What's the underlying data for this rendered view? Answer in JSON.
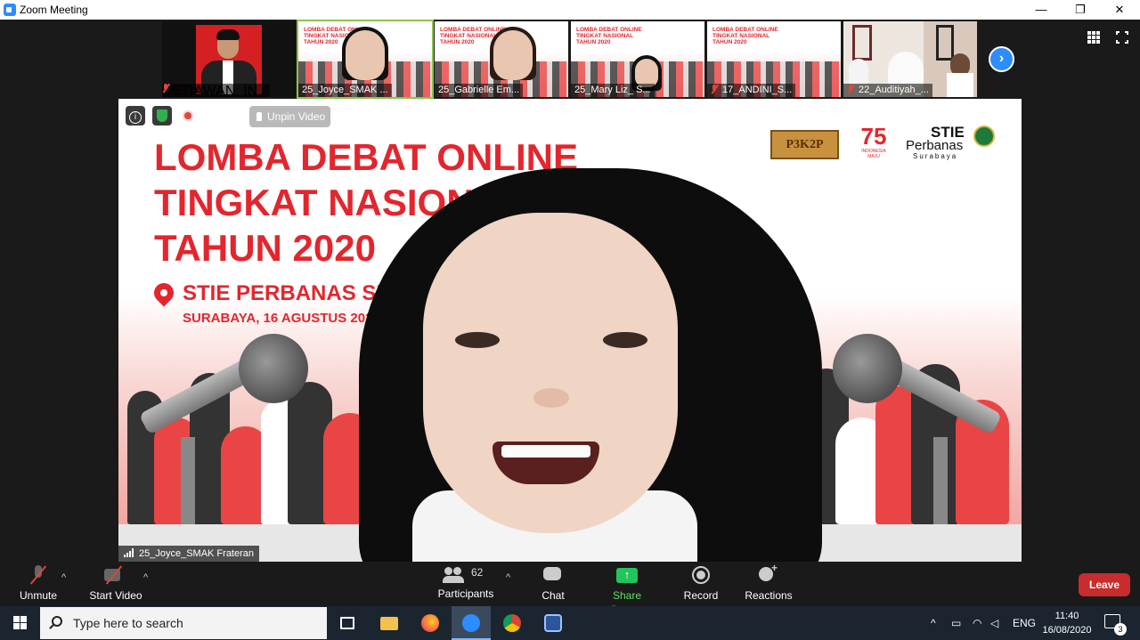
{
  "window": {
    "title": "Zoom Meeting",
    "minimize": "—",
    "restore": "❐",
    "close": "✕"
  },
  "thumbnails": [
    {
      "name": "SETIAWAN, IN...",
      "muted": true
    },
    {
      "name": "25_Joyce_SMAK ...",
      "muted": false,
      "active": true,
      "slide_title": "LOMBA DEBAT ONLINE\nTINGKAT NASIONAL\nTAHUN 2020"
    },
    {
      "name": "25_Gabrielle Em...",
      "muted": false,
      "slide_title": "LOMBA DEBAT ONLINE\nTINGKAT NASIONAL\nTAHUN 2020"
    },
    {
      "name": "25_Mary Liz_ S...",
      "muted": false,
      "slide_title": "LOMBA DEBAT ONLINE\nTINGKAT NASIONAL\nTAHUN 2020"
    },
    {
      "name": "17_ANDINI_S...",
      "muted": true,
      "slide_title": "LOMBA DEBAT ONLINE\nTINGKAT NASIONAL\nTAHUN 2020"
    },
    {
      "name": "22_Auditiyah_...",
      "muted": true
    }
  ],
  "main_video": {
    "slide_headline_1": "LOMBA DEBAT ONLINE",
    "slide_headline_2": "TINGKAT NASION",
    "slide_headline_3": "TAHUN 2020",
    "slide_location": "STIE PERBANAS SURA",
    "slide_date": "SURABAYA, 16 AGUSTUS 2020",
    "logo_p3k2p": "P3K2P",
    "logo_ri_num": "75",
    "logo_ri_text": "INDONESIA MAJU",
    "logo_stie_1": "STIE",
    "logo_stie_2": "Perbanas",
    "logo_stie_3": "Surabaya",
    "unpin_label": "Unpin Video",
    "speaker_name": "25_Joyce_SMAK Frateran",
    "info_icon": "i"
  },
  "controls": {
    "unmute": "Unmute",
    "start_video": "Start Video",
    "participants": "Participants",
    "participants_count": "62",
    "chat": "Chat",
    "share_screen": "Share Screen",
    "record": "Record",
    "reactions": "Reactions",
    "leave": "Leave",
    "caret": "^"
  },
  "taskbar": {
    "search_placeholder": "Type here to search",
    "language": "ENG",
    "time": "11:40",
    "date": "16/08/2020",
    "notifications": "3"
  },
  "colors": {
    "brand": "#2d8cff",
    "slide_red": "#e3262d",
    "share_green": "#23c45e",
    "leave_red": "#c92c2c"
  }
}
